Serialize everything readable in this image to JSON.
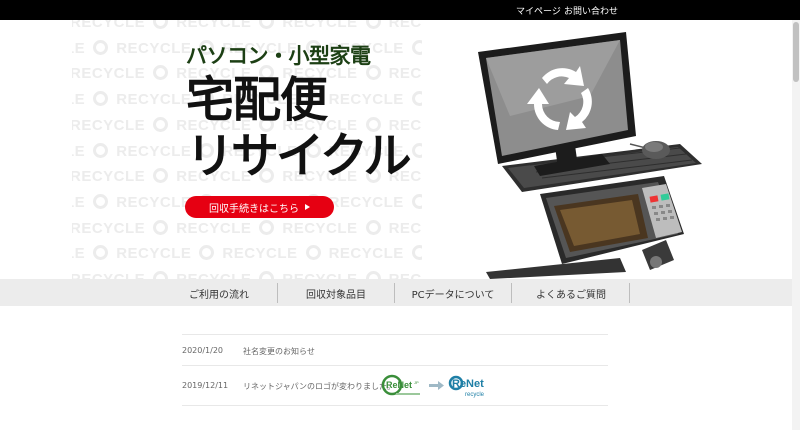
{
  "topbar": {
    "mypage_label": "マイページ",
    "contact_label": "お問い合わせ"
  },
  "hero": {
    "subtitle": "パソコン・小型家電",
    "title_line1": "宅配便",
    "title_line2": "リサイクル",
    "cta_label": "回収手続きはこちら",
    "background_word": "RECYCLE"
  },
  "nav": {
    "items": [
      {
        "label": "ご利用の流れ"
      },
      {
        "label": "回収対象品目"
      },
      {
        "label": "PCデータについて"
      },
      {
        "label": "よくあるご質問"
      }
    ]
  },
  "news": [
    {
      "date": "2020/1/20",
      "text": "社名変更のお知らせ"
    },
    {
      "date": "2019/12/11",
      "text": "リネットジャパンのロゴが変わりました。"
    }
  ],
  "logos": {
    "old": {
      "text": "ReNet",
      "sub": "JP"
    },
    "new": {
      "text": "ReNet",
      "sub": "recycle"
    }
  },
  "colors": {
    "accent": "#e60012",
    "subtitle": "#1c3f14",
    "logo_green": "#3a8e3a",
    "logo_teal": "#1e7fa6"
  }
}
